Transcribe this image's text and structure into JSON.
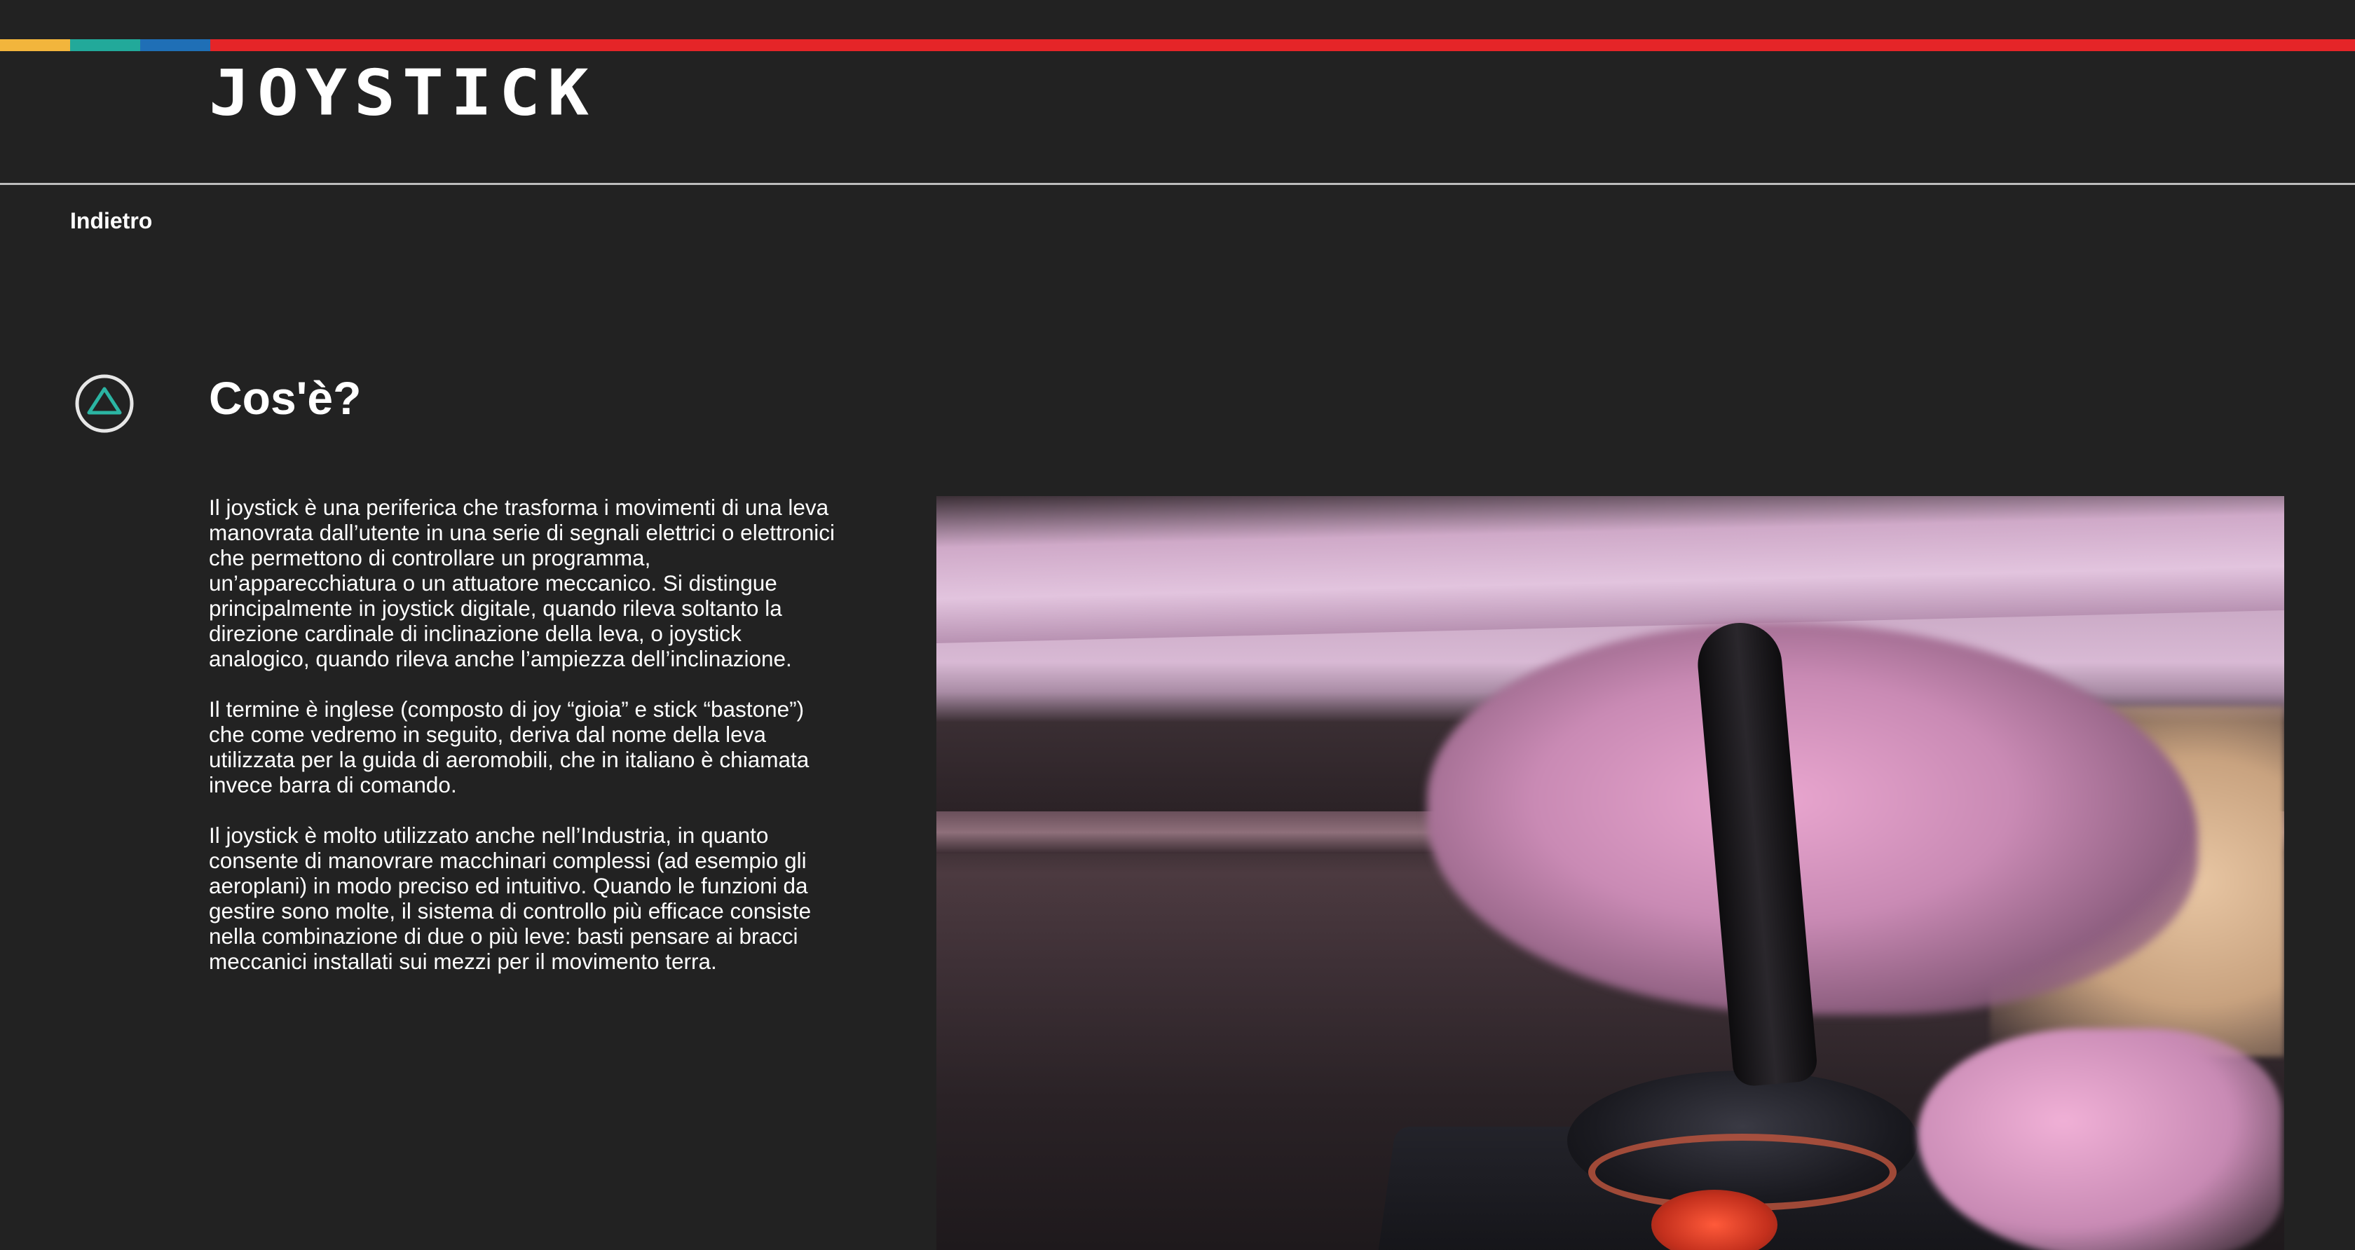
{
  "colors": {
    "background": "#222222",
    "stripe": [
      "#f2b53c",
      "#22a99a",
      "#1f6fb6",
      "#e52528"
    ],
    "triangle_icon": "#2bb5a3"
  },
  "header": {
    "logo_text": "JOYSTICK"
  },
  "nav": {
    "back_label": "Indietro"
  },
  "section": {
    "icon": "triangle-icon",
    "title": "Cos'è?",
    "paragraphs": [
      "Il joystick è una periferica che trasforma i movimenti di una leva manovrata dall’utente in una serie di segnali elettrici o elettronici che permettono di controllare un programma, un’apparecchiatura o un attuatore meccanico. Si distingue principalmente in joystick digitale, quando rileva soltanto la direzione cardinale di inclinazione della leva, o joystick analogico, quando rileva anche l’ampiezza dell’inclinazione.",
      "Il termine è inglese (composto di joy “gioia” e stick “bastone”) che come vedremo in seguito, deriva dal nome della leva utilizzata per la guida di aeromobili, che in italiano è chiamata invece barra di comando.",
      "Il joystick è molto utilizzato anche nell’Industria, in quanto consente di manovrare macchinari complessi (ad esempio gli aeroplani) in modo preciso ed intuitivo. Quando le funzioni da gestire sono molte, il sistema di controllo più efficace consiste nella combinazione di due o più leve: basti pensare ai bracci meccanici installati sui mezzi per il movimento terra."
    ]
  }
}
